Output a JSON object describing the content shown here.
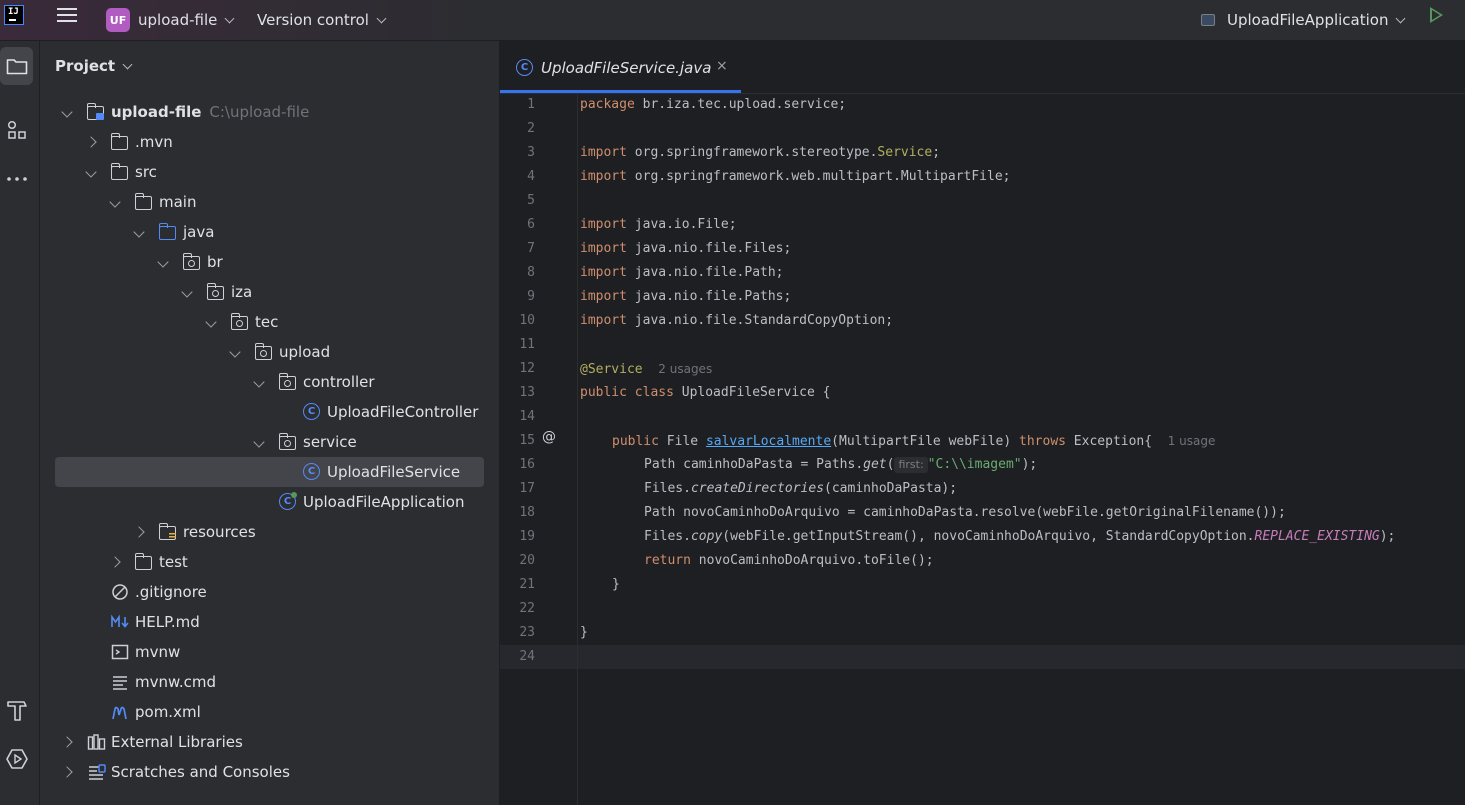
{
  "titlebar": {
    "project_badge": "UF",
    "project_name": "upload-file",
    "vcs_label": "Version control",
    "run_config": "UploadFileApplication"
  },
  "panel": {
    "title": "Project",
    "tree": [
      {
        "label": "upload-file",
        "hint": "C:\\upload-file",
        "icon": "module-folder-icon",
        "depth": 0,
        "arrow": "down"
      },
      {
        "label": ".mvn",
        "icon": "folder-icon",
        "depth": 1,
        "arrow": "right"
      },
      {
        "label": "src",
        "icon": "folder-icon",
        "depth": 1,
        "arrow": "down"
      },
      {
        "label": "main",
        "icon": "folder-icon",
        "depth": 2,
        "arrow": "down"
      },
      {
        "label": "java",
        "icon": "source-folder-icon",
        "depth": 3,
        "arrow": "down"
      },
      {
        "label": "br",
        "icon": "package-icon",
        "depth": 4,
        "arrow": "down"
      },
      {
        "label": "iza",
        "icon": "package-icon",
        "depth": 5,
        "arrow": "down"
      },
      {
        "label": "tec",
        "icon": "package-icon",
        "depth": 6,
        "arrow": "down"
      },
      {
        "label": "upload",
        "icon": "package-icon",
        "depth": 7,
        "arrow": "down"
      },
      {
        "label": "controller",
        "icon": "package-icon",
        "depth": 8,
        "arrow": "down"
      },
      {
        "label": "UploadFileController",
        "icon": "class-icon",
        "depth": 9,
        "arrow": ""
      },
      {
        "label": "service",
        "icon": "package-icon",
        "depth": 8,
        "arrow": "down"
      },
      {
        "label": "UploadFileService",
        "icon": "class-icon",
        "depth": 9,
        "arrow": "",
        "selected": true
      },
      {
        "label": "UploadFileApplication",
        "icon": "spring-app-class-icon",
        "depth": 8,
        "arrow": ""
      },
      {
        "label": "resources",
        "icon": "resources-folder-icon",
        "depth": 3,
        "arrow": "right"
      },
      {
        "label": "test",
        "icon": "folder-icon",
        "depth": 2,
        "arrow": "right"
      },
      {
        "label": ".gitignore",
        "icon": "ignore-file-icon",
        "depth": 1,
        "arrow": ""
      },
      {
        "label": "HELP.md",
        "icon": "markdown-icon",
        "depth": 1,
        "arrow": ""
      },
      {
        "label": "mvnw",
        "icon": "shell-script-icon",
        "depth": 1,
        "arrow": ""
      },
      {
        "label": "mvnw.cmd",
        "icon": "text-file-icon",
        "depth": 1,
        "arrow": ""
      },
      {
        "label": "pom.xml",
        "icon": "maven-icon",
        "depth": 1,
        "arrow": ""
      },
      {
        "label": "External Libraries",
        "icon": "libraries-icon",
        "depth": 0,
        "arrow": "right"
      },
      {
        "label": "Scratches and Consoles",
        "icon": "scratches-icon",
        "depth": 0,
        "arrow": "right"
      }
    ]
  },
  "editor": {
    "tab_label": "UploadFileService.java",
    "tab_close": "×",
    "class_icon_letter": "C",
    "line_count": 24,
    "lines": {
      "l1": [
        "package",
        " br.iza.tec.upload.service;"
      ],
      "l3": [
        "import",
        " org.springframework.stereotype.",
        "Service",
        ";"
      ],
      "l4": [
        "import",
        " org.springframework.web.multipart.MultipartFile;"
      ],
      "l6": [
        "import",
        " java.io.File;"
      ],
      "l7": [
        "import",
        " java.nio.file.Files;"
      ],
      "l8": [
        "import",
        " java.nio.file.Path;"
      ],
      "l9": [
        "import",
        " java.nio.file.Paths;"
      ],
      "l10": [
        "import",
        " java.nio.file.StandardCopyOption;"
      ],
      "l12": [
        "@Service",
        "2 usages"
      ],
      "l13": [
        "public class",
        " UploadFileService {"
      ],
      "l15": [
        "public",
        " File ",
        "salvarLocalmente",
        "(MultipartFile webFile) ",
        "throws",
        " Exception{",
        "1 usage"
      ],
      "l16": [
        "Path caminhoDaPasta = Paths.",
        "get",
        "(",
        "first:",
        "\"C:\\\\imagem\"",
        ");"
      ],
      "l17": [
        "Files.",
        "createDirectories",
        "(caminhoDaPasta);"
      ],
      "l18": [
        "Path novoCaminhoDoArquivo = caminhoDaPasta.resolve(webFile.getOriginalFilename());"
      ],
      "l19": [
        "Files.",
        "copy",
        "(webFile.getInputStream(), novoCaminhoDoArquivo, StandardCopyOption.",
        "REPLACE_EXISTING",
        ");"
      ],
      "l20": [
        "return",
        " novoCaminhoDoArquivo.toFile();"
      ],
      "l21": [
        "}"
      ],
      "l23": [
        "}"
      ]
    },
    "gutter_marker": "@"
  },
  "colors": {
    "keyword": "#cf8e6d",
    "annotation": "#b3ae60",
    "string": "#6aab73",
    "method": "#56a8f5",
    "constant": "#c77dbb",
    "accent": "#3574f0"
  }
}
